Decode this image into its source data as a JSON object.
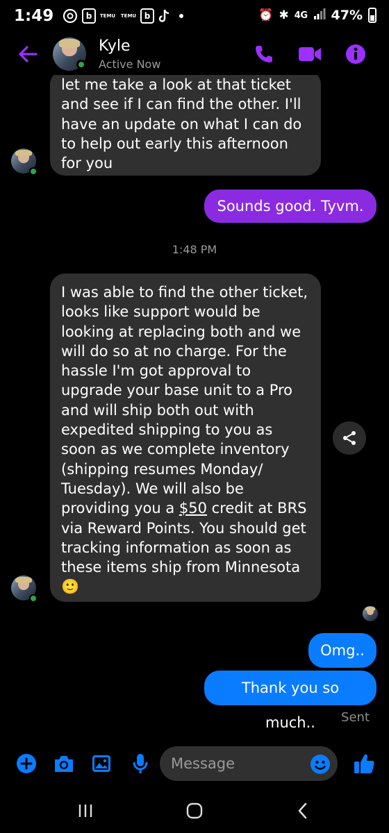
{
  "status_bar": {
    "time": "1:49",
    "notif_b": "b",
    "notif_temu": "TEMU",
    "network": "4G",
    "battery": "47%",
    "battery_level": 0.47
  },
  "header": {
    "contact_name": "Kyle",
    "contact_status": "Active Now"
  },
  "messages": {
    "m1_lines": [
      "let me take a look at that ticket",
      "and see if I can find the other. I'll",
      "have an update on what I can do",
      "to help out early this afternoon",
      "for you"
    ],
    "m2": "Sounds good.  Tyvm.",
    "timestamp": "1:48 PM",
    "m3_lines": [
      "I was able to find the other ticket,",
      "looks like support would be",
      "looking at replacing both and we",
      "will do so at no charge. For the",
      "hassle I'm got approval to",
      "upgrade your base unit to a Pro",
      "and will ship both out with",
      "expedited shipping to you as",
      "soon as we complete inventory",
      "(shipping resumes Monday/",
      "Tuesday). We will also be"
    ],
    "m3_line12_pre": "providing you a ",
    "m3_link": "$50",
    "m3_line12_post": " credit at BRS",
    "m3_lines_end": [
      "via Reward Points. You should get",
      "tracking information as soon as",
      "these items ship from Minnesota"
    ],
    "m3_emoji": "🙂",
    "m4": "Omg..",
    "m5": "Thank you so much..",
    "sent_label": "Sent"
  },
  "composer": {
    "placeholder": "Message"
  },
  "colors": {
    "accent_purple": "#8a2be2",
    "messenger_blue": "#0a7cff",
    "incoming_bubble": "#303030",
    "online_green": "#31a24c"
  },
  "icons": [
    "arrow-left-icon",
    "phone-icon",
    "video-icon",
    "info-icon",
    "share-icon",
    "plus-icon",
    "camera-icon",
    "image-icon",
    "microphone-icon",
    "emoji-icon",
    "thumbs-up-icon",
    "recents-icon",
    "home-icon",
    "back-icon"
  ]
}
